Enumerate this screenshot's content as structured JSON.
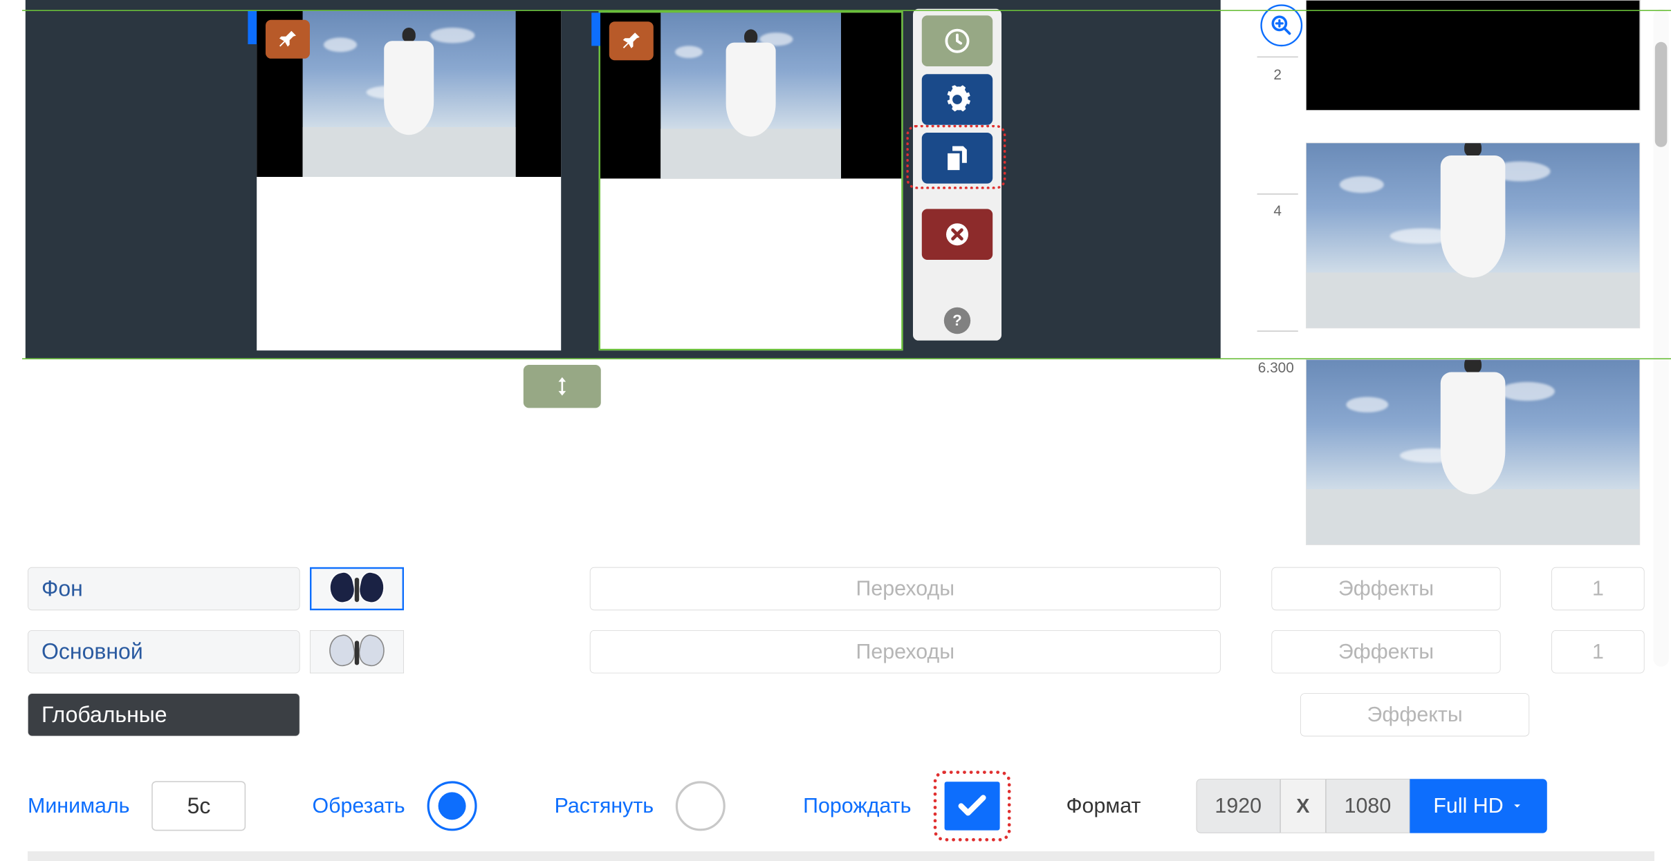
{
  "timeline": {
    "markers": {
      "m2": "2",
      "m4": "4",
      "m6": "6.300"
    }
  },
  "tool_panel": {
    "time": "time-icon",
    "settings": "gear-icon",
    "copy": "copy-icon",
    "delete": "close-icon",
    "help": "?"
  },
  "layers": {
    "bg_label": "Фон",
    "main_label": "Основной",
    "global_label": "Глобальные"
  },
  "row_buttons": {
    "transitions": "Переходы",
    "effects": "Эффекты",
    "count1": "1",
    "count2": "1"
  },
  "bottom": {
    "min_label": "Минималь",
    "min_value": "5с",
    "crop_label": "Обрезать",
    "stretch_label": "Растянуть",
    "spawn_label": "Порождать",
    "format_label": "Формат",
    "width": "1920",
    "height": "1080",
    "format_sep": "X",
    "preset": "Full HD"
  }
}
